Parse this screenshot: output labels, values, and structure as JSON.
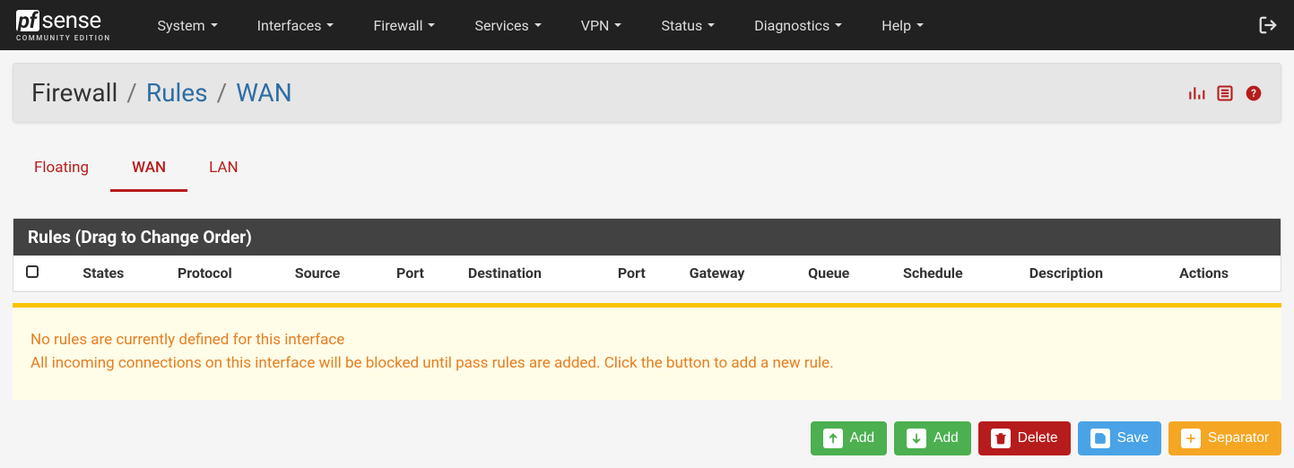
{
  "brand": {
    "pf": "pf",
    "sense": "sense",
    "sub": "COMMUNITY EDITION"
  },
  "nav": {
    "items": [
      {
        "label": "System"
      },
      {
        "label": "Interfaces"
      },
      {
        "label": "Firewall"
      },
      {
        "label": "Services"
      },
      {
        "label": "VPN"
      },
      {
        "label": "Status"
      },
      {
        "label": "Diagnostics"
      },
      {
        "label": "Help"
      }
    ]
  },
  "breadcrumb": {
    "root": "Firewall",
    "sep": "/",
    "section": "Rules",
    "leaf": "WAN"
  },
  "tabs": [
    {
      "label": "Floating",
      "active": false
    },
    {
      "label": "WAN",
      "active": true
    },
    {
      "label": "LAN",
      "active": false
    }
  ],
  "panel": {
    "heading": "Rules (Drag to Change Order)",
    "columns": [
      "States",
      "Protocol",
      "Source",
      "Port",
      "Destination",
      "Port",
      "Gateway",
      "Queue",
      "Schedule",
      "Description",
      "Actions"
    ]
  },
  "alert": {
    "line1": "No rules are currently defined for this interface",
    "line2": "All incoming connections on this interface will be blocked until pass rules are added. Click the button to add a new rule."
  },
  "buttons": {
    "add_top": "Add",
    "add_bottom": "Add",
    "delete": "Delete",
    "save": "Save",
    "separator": "Separator"
  }
}
